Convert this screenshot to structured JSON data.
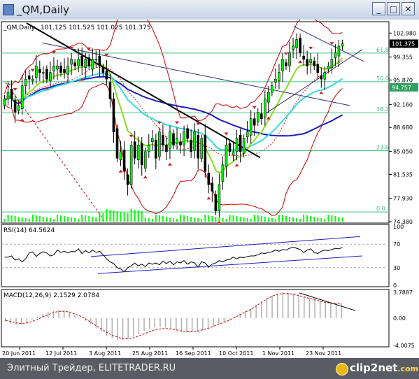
{
  "window": {
    "title": "_QM,Daily",
    "minimize": "_",
    "maximize": "□",
    "close": "✕"
  },
  "chart_data": [
    {
      "type": "candlestick",
      "title": "_QM,Daily",
      "ohlc_label": "101.125 101.525 101.025 101.375",
      "price_axis": [
        "102.980",
        "99.355",
        "95.870",
        "92.160",
        "88.680",
        "85.050",
        "81.535",
        "77.930",
        "74.380"
      ],
      "current_price": "101.375",
      "marked_price": "94.757",
      "ylim": [
        74.38,
        104.5
      ],
      "fib_levels": [
        {
          "label": "61.8",
          "value": 99.95
        },
        {
          "label": "50.0",
          "value": 95.6
        },
        {
          "label": "38.2",
          "value": 90.9
        },
        {
          "label": "23.6",
          "value": 85.15
        },
        {
          "label": "0.0",
          "value": 75.85
        }
      ],
      "x_labels": [
        "20 Jun 2011",
        "12 Jul 2011",
        "3 Aug 2011",
        "25 Aug 2011",
        "16 Sep 2011",
        "10 Oct 2011",
        "1 Nov 2011",
        "23 Nov 2011"
      ],
      "close": [
        93,
        94,
        93,
        91,
        92,
        95,
        96,
        96,
        96,
        98,
        97,
        97,
        96,
        97,
        98,
        98,
        97,
        97,
        98,
        99,
        98,
        99,
        98,
        99,
        98,
        99,
        99,
        98,
        97,
        96,
        93,
        88,
        84,
        85,
        82,
        80,
        86,
        84,
        86,
        83,
        85,
        86,
        87,
        84,
        88,
        86,
        85,
        88,
        86,
        87,
        86,
        88,
        87,
        85,
        88,
        84,
        87,
        82,
        80,
        79,
        76,
        80,
        83,
        86,
        85,
        85,
        87,
        85,
        87,
        88,
        90,
        89,
        91,
        90,
        93,
        94,
        95,
        96,
        97,
        99,
        98,
        100,
        101,
        102,
        100,
        99,
        98,
        99,
        98,
        97,
        96,
        97,
        98,
        99,
        100,
        101,
        101.375
      ],
      "colors": {
        "bull": "#00ff00",
        "bear": "#000000",
        "fib": "#40c080",
        "ema_fast": "#88dd22",
        "ema_mid": "#33dddd",
        "sma_slow": "#1c1cb8",
        "bands": "#c80000",
        "trend": "#000000"
      }
    },
    {
      "type": "line",
      "title": "RSI(14) 64.5624",
      "y_ticks": [
        "100",
        "70",
        "30",
        "0"
      ],
      "ylim": [
        0,
        100
      ],
      "values": [
        48,
        48,
        50,
        43,
        45,
        40,
        45,
        55,
        57,
        49,
        54,
        57,
        55,
        50,
        52,
        60,
        56,
        58,
        55,
        58,
        57,
        62,
        54,
        59,
        55,
        60,
        56,
        58,
        52,
        45,
        40,
        37,
        30,
        28,
        23,
        30,
        33,
        38,
        33,
        36,
        32,
        38,
        36,
        38,
        35,
        41,
        37,
        41,
        35,
        40,
        38,
        42,
        36,
        40,
        38,
        31,
        40,
        38,
        31,
        36,
        38,
        42,
        40,
        43,
        44,
        48,
        45,
        48,
        47,
        49,
        50,
        50,
        52,
        55,
        54,
        56,
        57,
        60,
        58,
        61,
        60,
        63,
        65,
        63,
        61,
        56,
        60,
        62,
        56,
        54,
        58,
        60,
        59,
        61,
        63,
        62,
        64.56
      ]
    },
    {
      "type": "bar",
      "title": "MACD(12,26,9) 2.1529 2.0784",
      "y_ticks": [
        "3.7887",
        "0.00",
        "-4.0075"
      ],
      "ylim": [
        -4.0075,
        3.7887
      ],
      "values": [
        -0.5,
        -0.8,
        -1.0,
        -0.9,
        -0.6,
        -0.2,
        0.2,
        0.6,
        0.9,
        1.1,
        1.2,
        1.1,
        0.8,
        0.4,
        0.0,
        -0.4,
        -0.9,
        -1.5,
        -2.0,
        -2.6,
        -3.0,
        -3.2,
        -3.2,
        -3.0,
        -2.7,
        -2.3,
        -1.9,
        -1.6,
        -1.4,
        -1.3,
        -1.4,
        -1.6,
        -1.8,
        -2.0,
        -2.1,
        -2.1,
        -2.0,
        -1.8,
        -1.5,
        -1.2,
        -0.9,
        -0.6,
        -0.2,
        0.2,
        0.6,
        1.0,
        1.4,
        1.9,
        2.4,
        2.9,
        3.3,
        3.6,
        3.8,
        3.7,
        3.6,
        3.4,
        3.2,
        3.0,
        2.8,
        2.6,
        2.4,
        2.3,
        2.2,
        2.15
      ],
      "signal": [
        -0.3,
        -0.5,
        -0.7,
        -0.8,
        -0.7,
        -0.5,
        -0.2,
        0.2,
        0.5,
        0.8,
        1.0,
        1.0,
        0.9,
        0.6,
        0.3,
        -0.1,
        -0.6,
        -1.1,
        -1.6,
        -2.1,
        -2.5,
        -2.8,
        -3.0,
        -3.0,
        -2.9,
        -2.6,
        -2.3,
        -2.0,
        -1.7,
        -1.6,
        -1.5,
        -1.6,
        -1.7,
        -1.9,
        -2.0,
        -2.0,
        -1.9,
        -1.7,
        -1.5,
        -1.2,
        -0.9,
        -0.6,
        -0.3,
        0.1,
        0.5,
        0.9,
        1.3,
        1.8,
        2.3,
        2.8,
        3.2,
        3.5,
        3.6,
        3.6,
        3.5,
        3.3,
        3.1,
        2.9,
        2.7,
        2.5,
        2.3,
        2.2,
        2.1,
        2.0784
      ]
    }
  ],
  "footer": {
    "text": "Элитный Трейдер, ELITETRADER.RU",
    "brand": "clip2net",
    "brand_suffix": ".com"
  }
}
